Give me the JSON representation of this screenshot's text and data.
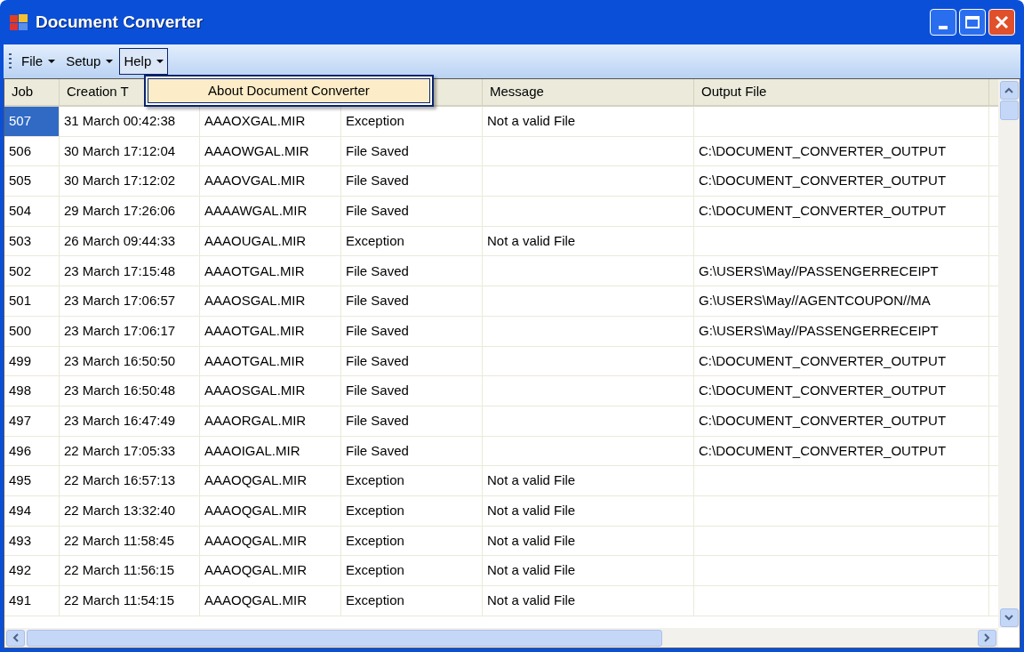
{
  "window": {
    "title": "Document Converter"
  },
  "menu": [
    {
      "label": "File",
      "selected": false
    },
    {
      "label": "Setup",
      "selected": false
    },
    {
      "label": "Help",
      "selected": true
    }
  ],
  "dropdown": {
    "items": [
      {
        "label": "About Document Converter",
        "selected": true
      }
    ]
  },
  "table": {
    "columns": [
      "Job",
      "Creation T",
      "",
      "",
      "Message",
      "Output File"
    ],
    "rows": [
      {
        "selected": true,
        "cells": [
          "507",
          "31 March 00:42:38",
          "AAAOXGAL.MIR",
          "Exception",
          "Not a valid File",
          ""
        ]
      },
      {
        "selected": false,
        "cells": [
          "506",
          "30 March 17:12:04",
          "AAAOWGAL.MIR",
          "File Saved",
          "",
          "C:\\DOCUMENT_CONVERTER_OUTPUT"
        ]
      },
      {
        "selected": false,
        "cells": [
          "505",
          "30 March 17:12:02",
          "AAAOVGAL.MIR",
          "File Saved",
          "",
          "C:\\DOCUMENT_CONVERTER_OUTPUT"
        ]
      },
      {
        "selected": false,
        "cells": [
          "504",
          "29 March 17:26:06",
          "AAAAWGAL.MIR",
          "File Saved",
          "",
          "C:\\DOCUMENT_CONVERTER_OUTPUT"
        ]
      },
      {
        "selected": false,
        "cells": [
          "503",
          "26 March 09:44:33",
          "AAAOUGAL.MIR",
          "Exception",
          "Not a valid File",
          ""
        ]
      },
      {
        "selected": false,
        "cells": [
          "502",
          "23 March 17:15:48",
          "AAAOTGAL.MIR",
          "File Saved",
          "",
          "G:\\USERS\\May//PASSENGERRECEIPT"
        ]
      },
      {
        "selected": false,
        "cells": [
          "501",
          "23 March 17:06:57",
          "AAAOSGAL.MIR",
          "File Saved",
          "",
          "G:\\USERS\\May//AGENTCOUPON//MA"
        ]
      },
      {
        "selected": false,
        "cells": [
          "500",
          "23 March 17:06:17",
          "AAAOTGAL.MIR",
          "File Saved",
          "",
          "G:\\USERS\\May//PASSENGERRECEIPT"
        ]
      },
      {
        "selected": false,
        "cells": [
          "499",
          "23 March 16:50:50",
          "AAAOTGAL.MIR",
          "File Saved",
          "",
          "C:\\DOCUMENT_CONVERTER_OUTPUT"
        ]
      },
      {
        "selected": false,
        "cells": [
          "498",
          "23 March 16:50:48",
          "AAAOSGAL.MIR",
          "File Saved",
          "",
          "C:\\DOCUMENT_CONVERTER_OUTPUT"
        ]
      },
      {
        "selected": false,
        "cells": [
          "497",
          "23 March 16:47:49",
          "AAAORGAL.MIR",
          "File Saved",
          "",
          "C:\\DOCUMENT_CONVERTER_OUTPUT"
        ]
      },
      {
        "selected": false,
        "cells": [
          "496",
          "22 March 17:05:33",
          "AAAOIGAL.MIR",
          "File Saved",
          "",
          "C:\\DOCUMENT_CONVERTER_OUTPUT"
        ]
      },
      {
        "selected": false,
        "cells": [
          "495",
          "22 March 16:57:13",
          "AAAOQGAL.MIR",
          "Exception",
          "Not a valid File",
          ""
        ]
      },
      {
        "selected": false,
        "cells": [
          "494",
          "22 March 13:32:40",
          "AAAOQGAL.MIR",
          "Exception",
          "Not a valid File",
          ""
        ]
      },
      {
        "selected": false,
        "cells": [
          "493",
          "22 March 11:58:45",
          "AAAOQGAL.MIR",
          "Exception",
          "Not a valid File",
          ""
        ]
      },
      {
        "selected": false,
        "cells": [
          "492",
          "22 March 11:56:15",
          "AAAOQGAL.MIR",
          "Exception",
          "Not a valid File",
          ""
        ]
      },
      {
        "selected": false,
        "cells": [
          "491",
          "22 March 11:54:15",
          "AAAOQGAL.MIR",
          "Exception",
          "Not a valid File",
          ""
        ]
      }
    ]
  }
}
